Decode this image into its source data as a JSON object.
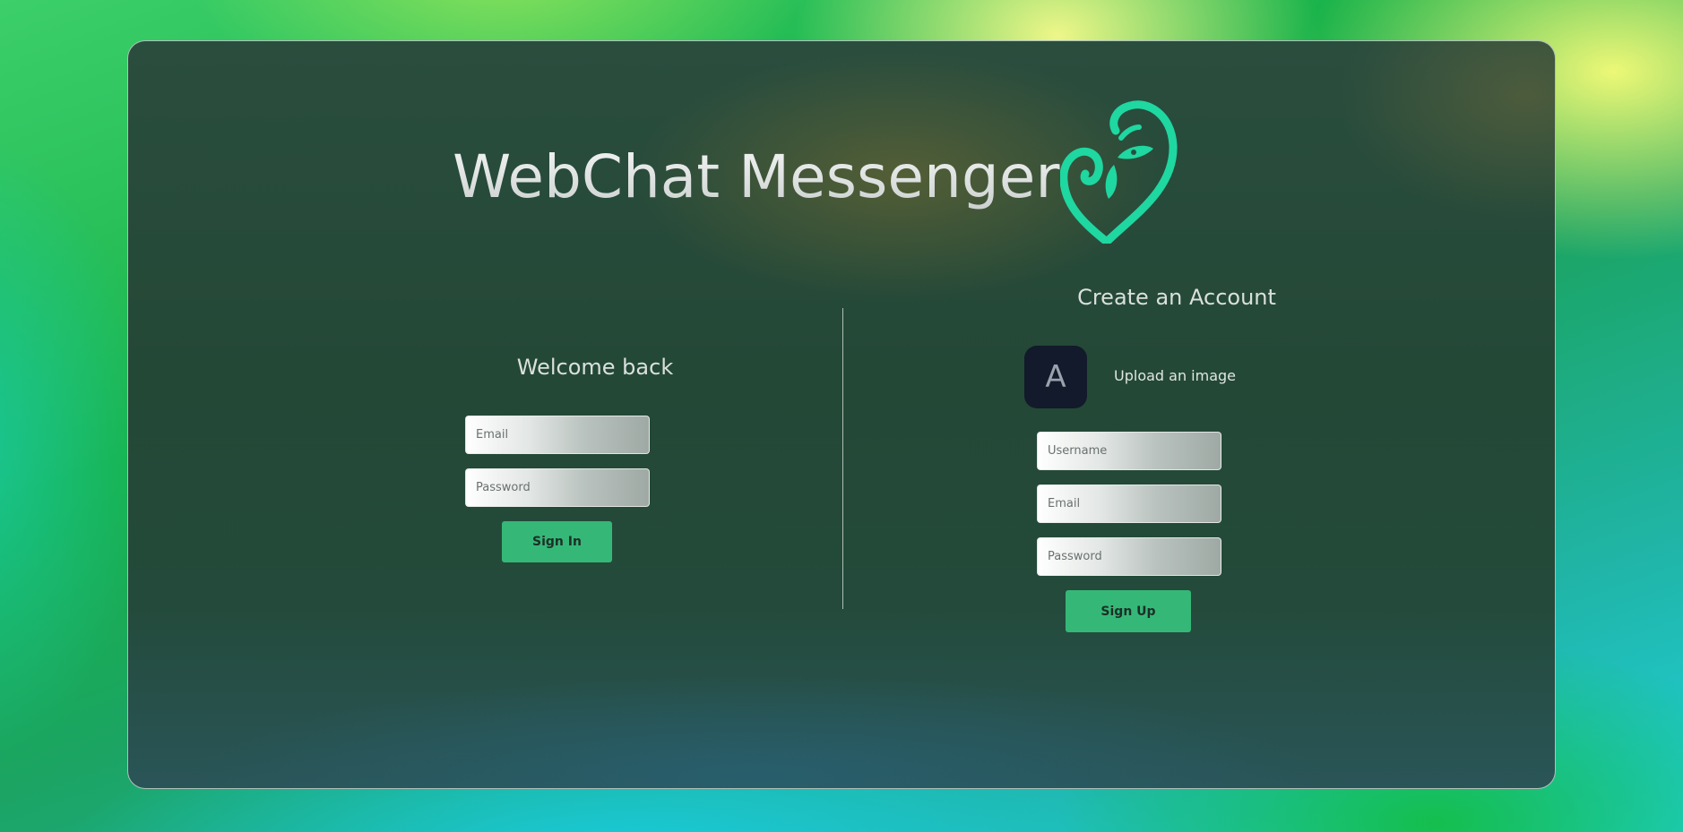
{
  "app": {
    "title": "WebChat Messenger",
    "logo_icon": "heart-leaf-logo-icon",
    "accent_color": "#1fd7a0"
  },
  "login": {
    "heading": "Welcome back",
    "email_placeholder": "Email",
    "password_placeholder": "Password",
    "submit_label": "Sign In"
  },
  "signup": {
    "heading": "Create an Account",
    "avatar_letter": "A",
    "upload_label": "Upload an image",
    "username_placeholder": "Username",
    "email_placeholder": "Email",
    "password_placeholder": "Password",
    "submit_label": "Sign Up"
  },
  "colors": {
    "button": "#35b877",
    "avatar_bg": "#121a2b"
  }
}
